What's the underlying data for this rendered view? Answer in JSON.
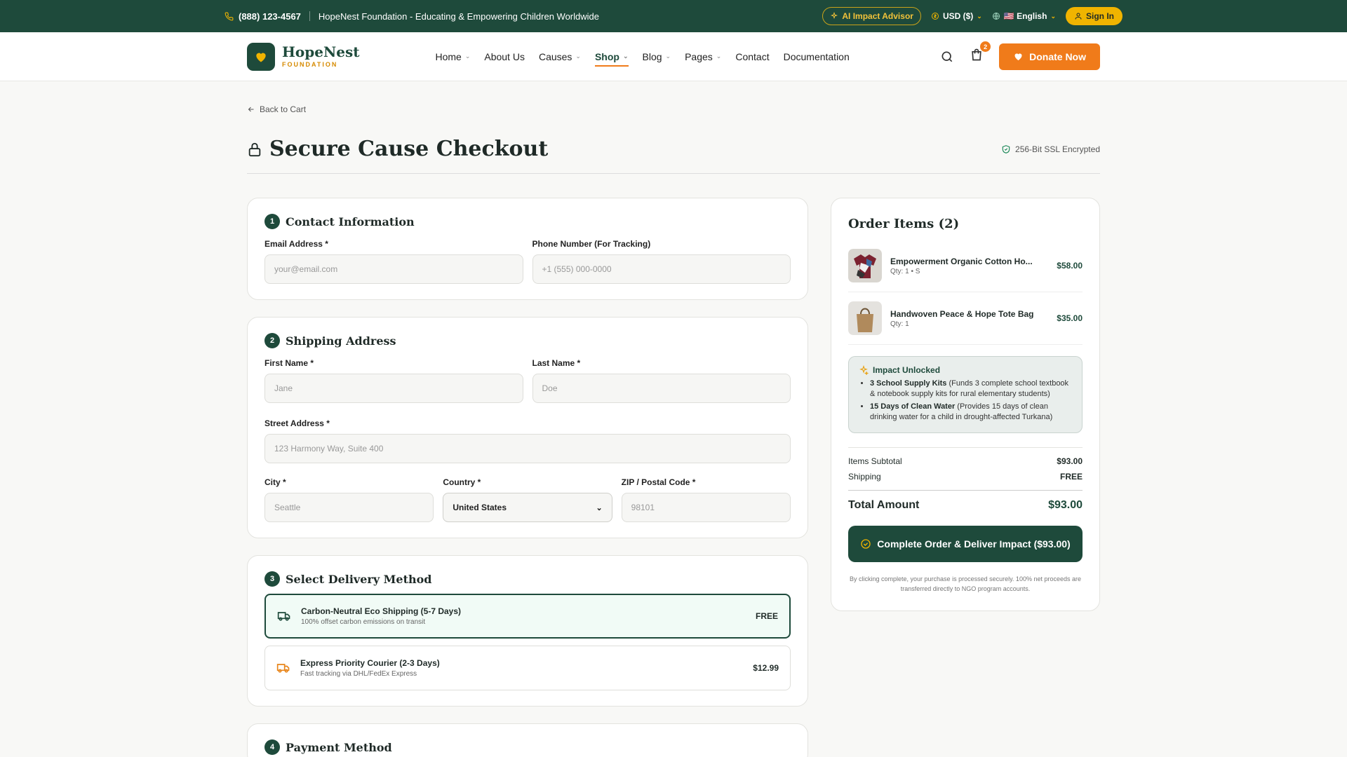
{
  "topbar": {
    "phone": "(888) 123-4567",
    "tagline": "HopeNest Foundation - Educating & Empowering Children Worldwide",
    "ai_advisor": "AI Impact Advisor",
    "currency": "USD ($)",
    "language": "🇺🇸 English",
    "sign_in": "Sign In"
  },
  "header": {
    "logo_name": "HopeNest",
    "logo_sub": "FOUNDATION",
    "nav": [
      {
        "label": "Home"
      },
      {
        "label": "About Us"
      },
      {
        "label": "Causes"
      },
      {
        "label": "Shop"
      },
      {
        "label": "Blog"
      },
      {
        "label": "Pages"
      },
      {
        "label": "Contact"
      },
      {
        "label": "Documentation"
      }
    ],
    "cart_count": "2",
    "donate": "Donate Now"
  },
  "page": {
    "back": "Back to Cart",
    "title": "Secure Cause Checkout",
    "ssl": "256-Bit SSL Encrypted"
  },
  "contact": {
    "num": "1",
    "title": "Contact Information",
    "email_label": "Email Address *",
    "email_placeholder": "your@email.com",
    "phone_label": "Phone Number (For Tracking)",
    "phone_placeholder": "+1 (555) 000-0000"
  },
  "shipping": {
    "num": "2",
    "title": "Shipping Address",
    "first_label": "First Name *",
    "first_placeholder": "Jane",
    "last_label": "Last Name *",
    "last_placeholder": "Doe",
    "street_label": "Street Address *",
    "street_placeholder": "123 Harmony Way, Suite 400",
    "city_label": "City *",
    "city_placeholder": "Seattle",
    "country_label": "Country *",
    "country_value": "United States",
    "zip_label": "ZIP / Postal Code *",
    "zip_placeholder": "98101"
  },
  "delivery": {
    "num": "3",
    "title": "Select Delivery Method",
    "options": [
      {
        "title": "Carbon-Neutral Eco Shipping (5-7 Days)",
        "sub": "100% offset carbon emissions on transit",
        "price": "FREE",
        "icon_color": "#1e4a3b"
      },
      {
        "title": "Express Priority Courier (2-3 Days)",
        "sub": "Fast tracking via DHL/FedEx Express",
        "price": "$12.99",
        "icon_color": "#e8851a"
      }
    ]
  },
  "payment": {
    "num": "4",
    "title": "Payment Method"
  },
  "order": {
    "title": "Order Items (2)",
    "items": [
      {
        "name": "Empowerment Organic Cotton Ho...",
        "qty": "Qty: 1 • S",
        "price": "$58.00"
      },
      {
        "name": "Handwoven Peace & Hope Tote Bag",
        "qty": "Qty: 1",
        "price": "$35.00"
      }
    ],
    "impact_title": "Impact Unlocked",
    "impact": [
      {
        "bold": "3 School Supply Kits",
        "rest": " (Funds 3 complete school textbook & notebook supply kits for rural elementary students)"
      },
      {
        "bold": "15 Days of Clean Water",
        "rest": " (Provides 15 days of clean drinking water for a child in drought-affected Turkana)"
      }
    ],
    "subtotal_label": "Items Subtotal",
    "subtotal": "$93.00",
    "shipping_label": "Shipping",
    "shipping": "FREE",
    "total_label": "Total Amount",
    "total": "$93.00",
    "complete": "Complete Order & Deliver Impact ($93.00)",
    "fine": "By clicking complete, your purchase is processed securely. 100% net proceeds are transferred directly to NGO program accounts."
  },
  "colors": {
    "brand": "#1e4a3b",
    "accent": "#f07b1a",
    "gold": "#f0b400"
  }
}
